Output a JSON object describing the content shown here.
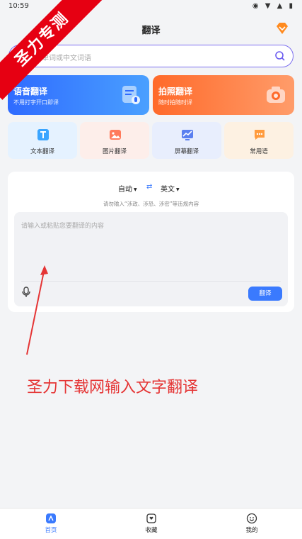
{
  "status_bar": {
    "time": "10:59",
    "icons": "◉ ▼ ▲ ▮"
  },
  "watermark": {
    "text": "圣力专测"
  },
  "header": {
    "title": "翻译",
    "vip_icon": "diamond-icon"
  },
  "search": {
    "placeholder": "英文单词或中文词语",
    "icon": "search-icon"
  },
  "feature_cards": [
    {
      "title": "语音翻译",
      "subtitle": "不用打字开口即译",
      "icon": "voice-doc-icon"
    },
    {
      "title": "拍照翻译",
      "subtitle": "随时拍随时译",
      "icon": "camera-icon"
    }
  ],
  "tools": [
    {
      "label": "文本翻译",
      "icon": "text-icon"
    },
    {
      "label": "图片翻译",
      "icon": "image-icon"
    },
    {
      "label": "屏幕翻译",
      "icon": "screen-icon"
    },
    {
      "label": "常用语",
      "icon": "chat-icon"
    }
  ],
  "translator": {
    "from_lang": "自动",
    "swap_icon": "swap-icon",
    "to_lang": "英文",
    "hint": "请勿输入“涉政、涉恐、涉密”等违规内容",
    "input_placeholder": "请输入或粘贴您要翻译的内容",
    "mic_icon": "mic-icon",
    "translate_label": "翻译"
  },
  "annotation": {
    "text": "圣力下载网输入文字翻译"
  },
  "bottom_nav": [
    {
      "label": "首页",
      "icon": "home-icon",
      "active": true
    },
    {
      "label": "收藏",
      "icon": "bookmark-icon",
      "active": false
    },
    {
      "label": "我的",
      "icon": "smile-icon",
      "active": false
    }
  ],
  "colors": {
    "accent": "#3a7afe",
    "photo_card": "#ff6a2a",
    "annotation": "#e53535",
    "watermark": "#e60012"
  }
}
